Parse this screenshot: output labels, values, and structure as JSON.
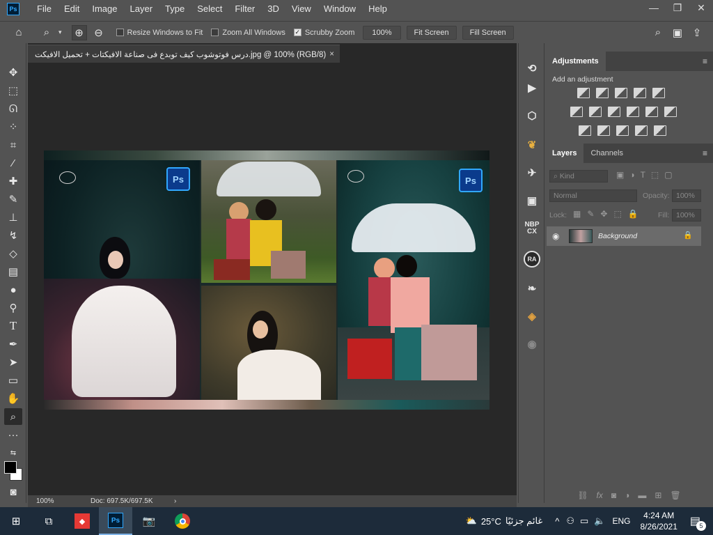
{
  "app": {
    "logo_text": "Ps"
  },
  "menu": [
    "File",
    "Edit",
    "Image",
    "Layer",
    "Type",
    "Select",
    "Filter",
    "3D",
    "View",
    "Window",
    "Help"
  ],
  "window_controls": {
    "minimize": "—",
    "restore": "❐",
    "close": "✕"
  },
  "options_bar": {
    "resize_windows_label": "Resize Windows to Fit",
    "zoom_all_label": "Zoom All Windows",
    "scrubby_zoom_label": "Scrubby Zoom",
    "resize_windows_checked": false,
    "zoom_all_checked": false,
    "scrubby_zoom_checked": true,
    "zoom_percent": "100%",
    "fit_screen_label": "Fit Screen",
    "fill_screen_label": "Fill Screen"
  },
  "document": {
    "tab_title": "درس فوتوشوب كيف توبدع فى صناعة الافيكتات + تحميل الافيكت.jpg @ 100% (RGB/8)",
    "tab_close": "×",
    "canvas_ps_badge": "Ps"
  },
  "status_bar": {
    "zoom": "100%",
    "doc_info": "Doc: 697.5K/697.5K",
    "arrow": "›"
  },
  "panels": {
    "adjustments_tab": "Adjustments",
    "add_adjustment": "Add an adjustment",
    "layers_tab": "Layers",
    "channels_tab": "Channels",
    "filter_kind": "Kind",
    "blend_mode": "Normal",
    "opacity_label": "Opacity:",
    "opacity_value": "100%",
    "lock_label": "Lock:",
    "fill_label": "Fill:",
    "fill_value": "100%",
    "layer_name": "Background"
  },
  "strip_labels": {
    "nbp": "NBP",
    "cx": "CX",
    "ra": "RA"
  },
  "taskbar": {
    "weather_temp": "25°C",
    "weather_text": "غائم جزئيًا",
    "language": "ENG",
    "time": "4:24 AM",
    "date": "8/26/2021",
    "notification_count": "5"
  },
  "icons": {
    "home": "home-icon",
    "zoom": "zoom-icon",
    "zoom_in": "zoom-in-icon",
    "zoom_out": "zoom-out-icon",
    "search": "search-icon",
    "workspace": "workspace-icon",
    "share": "share-icon"
  },
  "colors": {
    "accent": "#31a8ff",
    "app_bg": "#535353",
    "dark_bg": "#282828",
    "taskbar": "#1d2b3a"
  }
}
